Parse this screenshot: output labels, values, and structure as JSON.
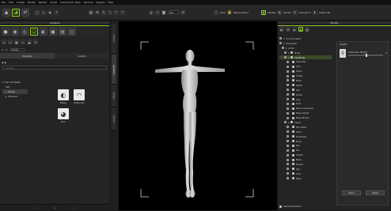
{
  "menu": [
    "File",
    "Edit",
    "Create",
    "Modify",
    "Render",
    "Script",
    "Submission Tools",
    "Window",
    "Plugins",
    "Help"
  ],
  "toolbar": {
    "headshot_label": "HEADSHOT",
    "view_select": "Pan",
    "pose": "Pose",
    "manipulation": "Manipulation",
    "modify": "Modify",
    "morph": "Morph",
    "transform": "Transform",
    "install_label": "Install 3D"
  },
  "content": {
    "title": "Content",
    "group_select": "Group",
    "tabs": [
      "Template",
      "Custom"
    ],
    "search_placeholder": "Search",
    "tree": [
      "Hair Template",
      "Slot",
      "Group",
      "Element"
    ],
    "selected": "Group",
    "items": [
      {
        "label": "Bases",
        "icon": "◐"
      },
      {
        "label": "Eyebrows",
        "icon": "◠"
      },
      {
        "label": "Hair",
        "icon": "◕"
      }
    ]
  },
  "side_tabs": [
    "Scene",
    "Content",
    "Stage",
    "Visual"
  ],
  "modify": {
    "title": "Modify",
    "filter_label": "Search",
    "tree": [
      {
        "label": "Current Used",
        "level": 0
      },
      {
        "label": "Character",
        "level": 0
      },
      {
        "label": "Actor",
        "level": 1
      },
      {
        "label": "Body",
        "level": 2
      },
      {
        "label": "Full Body",
        "level": 2,
        "selected": true
      },
      {
        "label": "Shoulder",
        "level": 3
      },
      {
        "label": "Arm",
        "level": 3
      },
      {
        "label": "Hand",
        "level": 3
      },
      {
        "label": "Chest",
        "level": 3
      },
      {
        "label": "Back",
        "level": 3
      },
      {
        "label": "Waist",
        "level": 3
      },
      {
        "label": "Hip",
        "level": 3
      },
      {
        "label": "Glute",
        "level": 3
      },
      {
        "label": "Leg",
        "level": 3
      },
      {
        "label": "Foot",
        "level": 3
      },
      {
        "label": "Pose Corrective",
        "level": 3
      },
      {
        "label": "Pose Adjust",
        "level": 3
      },
      {
        "label": "Base Morph",
        "level": 3
      },
      {
        "label": "Head",
        "level": 2
      },
      {
        "label": "Full Head",
        "level": 3
      },
      {
        "label": "Skull",
        "level": 3
      },
      {
        "label": "Forehead",
        "level": 3
      },
      {
        "label": "Brow",
        "level": 3
      },
      {
        "label": "Eye",
        "level": 3
      },
      {
        "label": "Ear",
        "level": 3
      },
      {
        "label": "Cheek",
        "level": 3
      },
      {
        "label": "Nose",
        "level": 3
      },
      {
        "label": "Mouth",
        "level": 3
      },
      {
        "label": "Jaw",
        "level": 3
      },
      {
        "label": "Chin",
        "level": 3
      },
      {
        "label": "Neck",
        "level": 3
      }
    ],
    "show_all": "Show Sub Items",
    "inspector_title": "Height",
    "morph_name": "Character Height",
    "morph_value": "0",
    "buttons": [
      "Save",
      "Reset"
    ]
  }
}
